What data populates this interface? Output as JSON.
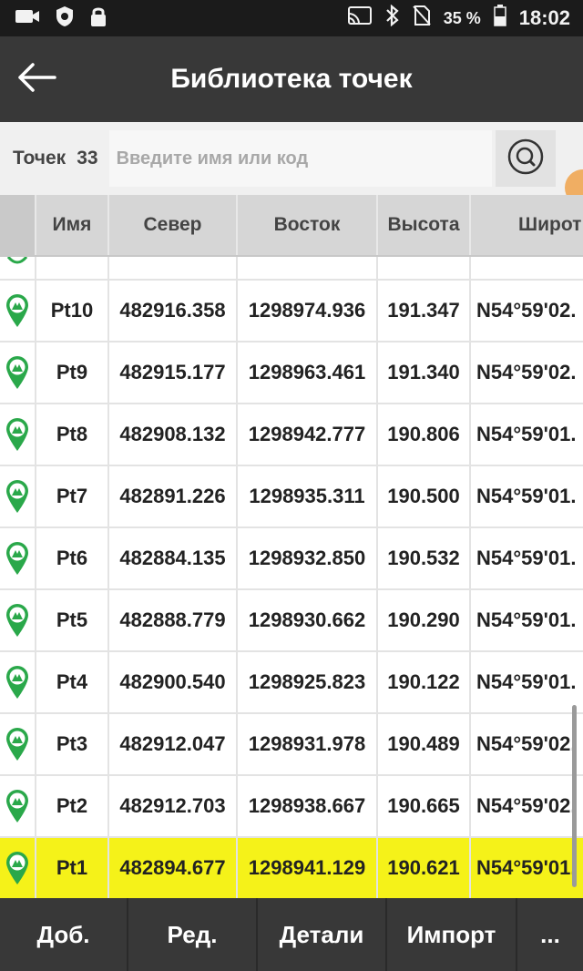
{
  "status_bar": {
    "icons": [
      "camera-icon",
      "shield-icon",
      "lock-icon",
      "cast-icon",
      "bluetooth-icon",
      "no-sim-icon",
      "battery-icon"
    ],
    "battery": "35 %",
    "time": "18:02"
  },
  "app_bar": {
    "title": "Библиотека точек",
    "back_icon": "arrow-left-icon"
  },
  "search": {
    "count_label": "Точек",
    "count_value": "33",
    "placeholder": "Введите имя или код",
    "search_icon": "search-icon"
  },
  "table": {
    "columns": [
      "",
      "Имя",
      "Север",
      "Восток",
      "Высота",
      "Широт"
    ],
    "rows": [
      {
        "name": "Pt10",
        "north": "482916.358",
        "east": "1298974.936",
        "height": "191.347",
        "lat": "N54°59'02."
      },
      {
        "name": "Pt9",
        "north": "482915.177",
        "east": "1298963.461",
        "height": "191.340",
        "lat": "N54°59'02."
      },
      {
        "name": "Pt8",
        "north": "482908.132",
        "east": "1298942.777",
        "height": "190.806",
        "lat": "N54°59'01."
      },
      {
        "name": "Pt7",
        "north": "482891.226",
        "east": "1298935.311",
        "height": "190.500",
        "lat": "N54°59'01."
      },
      {
        "name": "Pt6",
        "north": "482884.135",
        "east": "1298932.850",
        "height": "190.532",
        "lat": "N54°59'01."
      },
      {
        "name": "Pt5",
        "north": "482888.779",
        "east": "1298930.662",
        "height": "190.290",
        "lat": "N54°59'01."
      },
      {
        "name": "Pt4",
        "north": "482900.540",
        "east": "1298925.823",
        "height": "190.122",
        "lat": "N54°59'01."
      },
      {
        "name": "Pt3",
        "north": "482912.047",
        "east": "1298931.978",
        "height": "190.489",
        "lat": "N54°59'02."
      },
      {
        "name": "Pt2",
        "north": "482912.703",
        "east": "1298938.667",
        "height": "190.665",
        "lat": "N54°59'02."
      },
      {
        "name": "Pt1",
        "north": "482894.677",
        "east": "1298941.129",
        "height": "190.621",
        "lat": "N54°59'01."
      }
    ],
    "selected_row": "Pt1",
    "row_icon": "survey-point-icon",
    "selected_color": "#f5f219"
  },
  "bottom_bar": {
    "add": "Доб.",
    "edit": "Ред.",
    "details": "Детали",
    "import": "Импорт",
    "more": "..."
  },
  "colors": {
    "app_bar": "#383838",
    "status_bar": "#1b1b1b",
    "icon_green": "#2aa84a",
    "highlight": "#f5f219"
  }
}
